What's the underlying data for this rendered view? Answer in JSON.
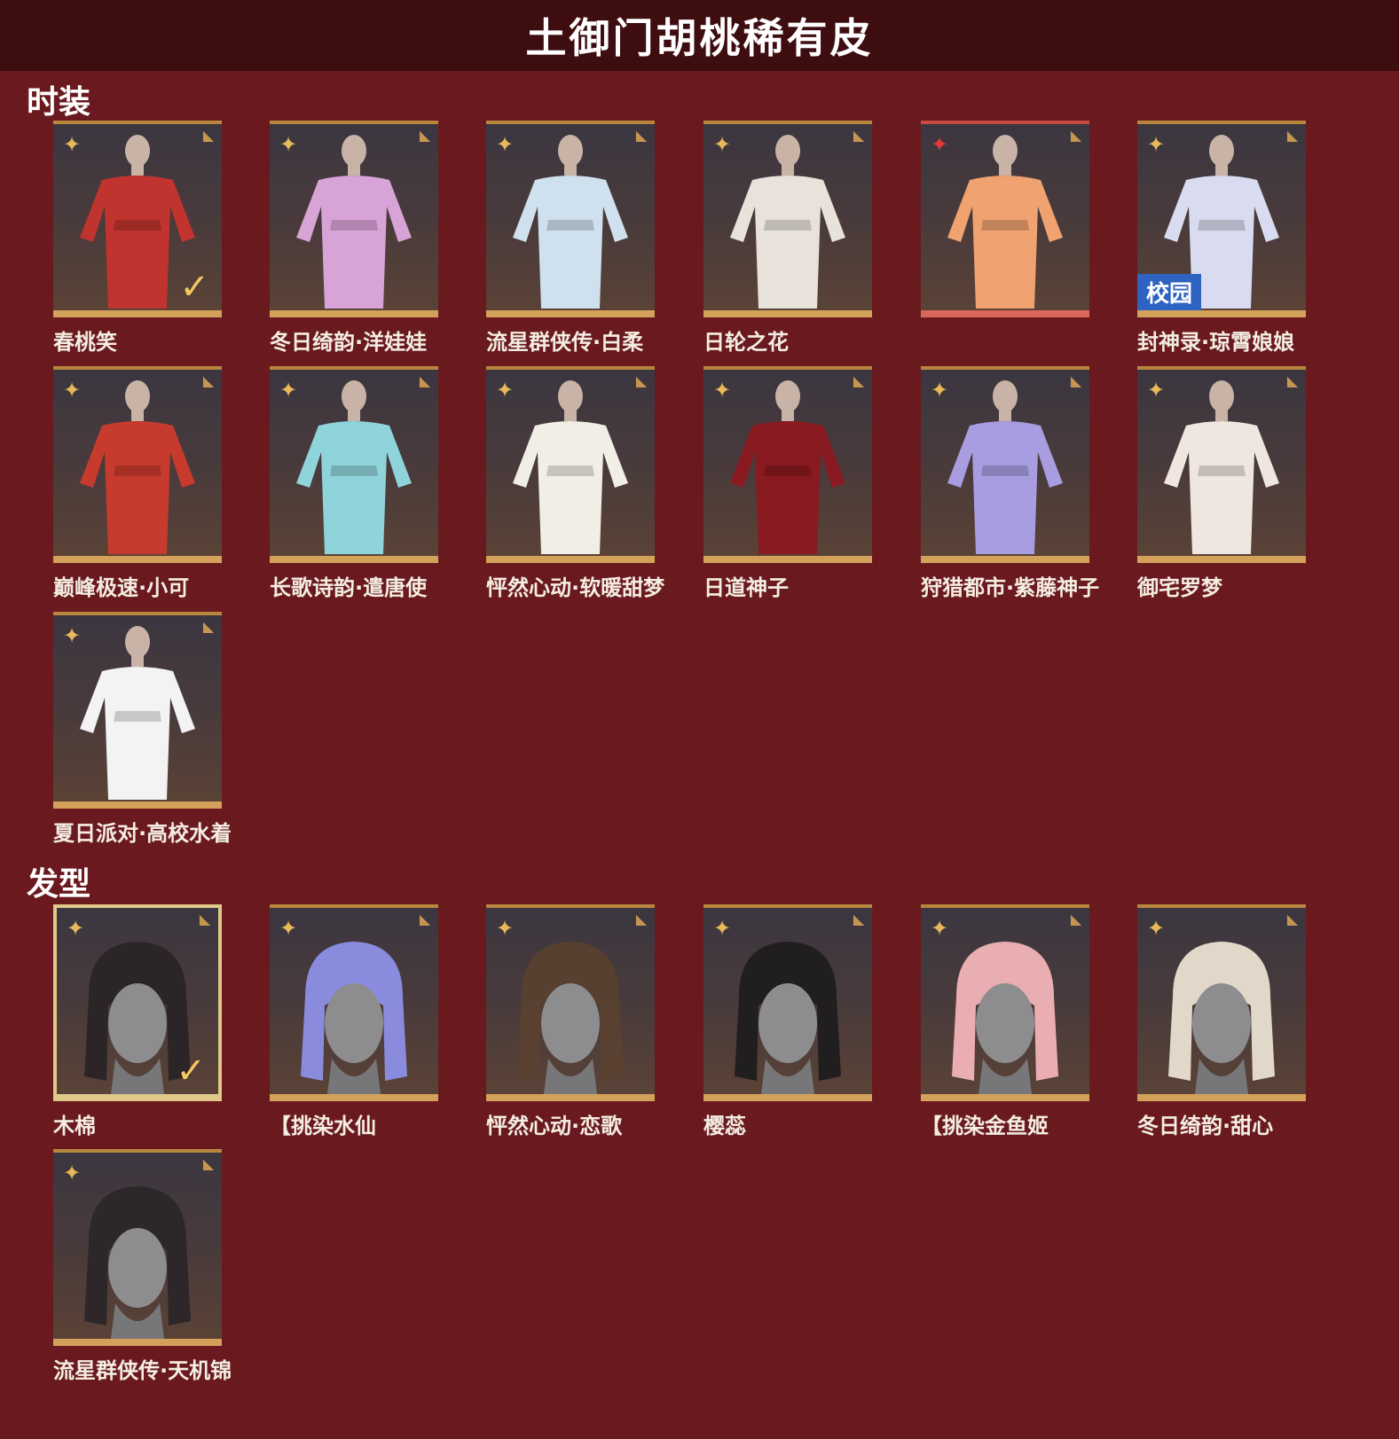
{
  "header": {
    "title": "土御门胡桃稀有皮"
  },
  "sections": {
    "costumes": {
      "title": "时装",
      "items": [
        {
          "name": "春桃笑",
          "color": "#c0332e",
          "checked": true,
          "tag": ""
        },
        {
          "name": "冬日绮韵·洋娃娃",
          "color": "#d8a3d6",
          "checked": false,
          "tag": ""
        },
        {
          "name": "流星群侠传·白柔",
          "color": "#cfe0ee",
          "checked": false,
          "tag": ""
        },
        {
          "name": "日轮之花",
          "color": "#e8e2da",
          "checked": false,
          "tag": ""
        },
        {
          "name": "",
          "color": "#f0a270",
          "checked": false,
          "tag": ""
        },
        {
          "name": "封神录·琼霄娘娘",
          "color": "#d9dcf0",
          "checked": false,
          "tag": "校园"
        },
        {
          "name": "巅峰极速·小可",
          "color": "#c73a2e",
          "checked": false,
          "tag": ""
        },
        {
          "name": "长歌诗韵·遣唐使",
          "color": "#8fd4db",
          "checked": false,
          "tag": ""
        },
        {
          "name": "怦然心动·软暖甜梦",
          "color": "#f1eee6",
          "checked": false,
          "tag": ""
        },
        {
          "name": "日道神子",
          "color": "#8a1a22",
          "checked": false,
          "tag": ""
        },
        {
          "name": "狩猎都市·紫藤神子",
          "color": "#a89de0",
          "checked": false,
          "tag": ""
        },
        {
          "name": "御宅罗梦",
          "color": "#efe6df",
          "checked": false,
          "tag": ""
        },
        {
          "name": "夏日派对·高校水着",
          "color": "#f3f3f3",
          "checked": false,
          "tag": ""
        }
      ]
    },
    "hairstyles": {
      "title": "发型",
      "items": [
        {
          "name": "木棉",
          "color": "#2a2426",
          "checked": true,
          "tag": ""
        },
        {
          "name": "【挑染水仙",
          "color": "#8d8fe6",
          "checked": false,
          "tag": ""
        },
        {
          "name": "怦然心动·恋歌",
          "color": "#5a4030",
          "checked": false,
          "tag": ""
        },
        {
          "name": "樱蕊",
          "color": "#1f1c1e",
          "checked": false,
          "tag": ""
        },
        {
          "name": "【挑染金鱼姬",
          "color": "#f2b4b8",
          "checked": false,
          "tag": ""
        },
        {
          "name": "冬日绮韵·甜心",
          "color": "#eae0d2",
          "checked": false,
          "tag": ""
        },
        {
          "name": "流星群侠传·天机锦",
          "color": "#2b2628",
          "checked": false,
          "tag": ""
        }
      ]
    }
  },
  "icons": {
    "star": "four-point-star-icon",
    "corner": "leaf-corner-icon",
    "check": "checkmark-icon"
  }
}
